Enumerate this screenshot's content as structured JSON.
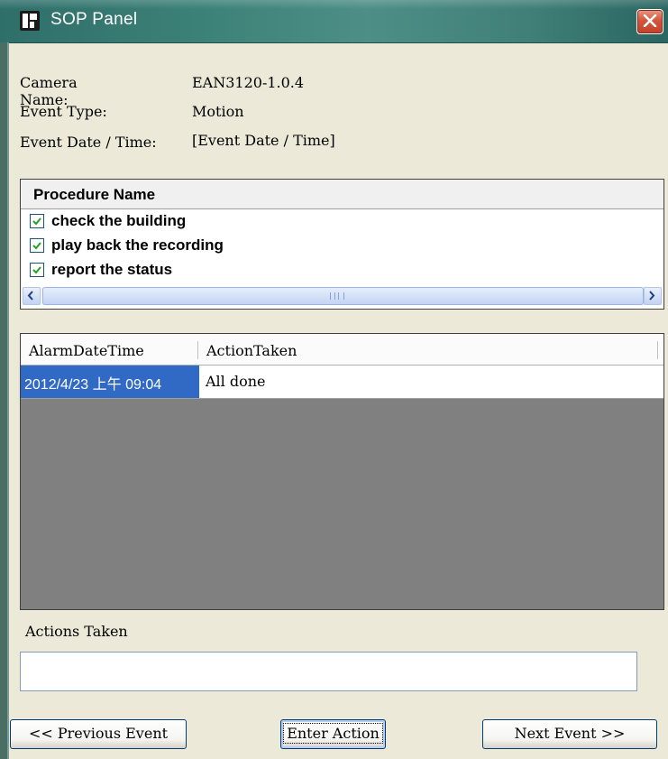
{
  "window": {
    "title": "SOP Panel",
    "close_icon": "close-icon",
    "app_icon": "sop-app-icon"
  },
  "info": {
    "camera_name_label": "Camera Name:",
    "camera_name_value": "EAN3120-1.0.4",
    "event_type_label": "Event Type:",
    "event_type_value": "Motion",
    "event_datetime_label": "Event Date / Time:",
    "event_datetime_value": "[Event Date / Time]"
  },
  "procedures": {
    "header": "Procedure Name",
    "items": [
      {
        "label": "check the building",
        "checked": true
      },
      {
        "label": "play back the recording",
        "checked": true
      },
      {
        "label": "report the status",
        "checked": true
      }
    ]
  },
  "alarm_table": {
    "columns": [
      "AlarmDateTime",
      "ActionTaken"
    ],
    "rows": [
      {
        "alarm_datetime": "2012/4/23 上午 09:04",
        "action_taken": "All done"
      }
    ]
  },
  "actions_taken": {
    "label": "Actions Taken",
    "value": ""
  },
  "buttons": {
    "previous": "<< Previous Event",
    "enter": "Enter Action",
    "next": "Next Event >>"
  },
  "colors": {
    "selection": "#316ac5",
    "grid_empty": "#808080",
    "titlebar": "#3c8177"
  }
}
